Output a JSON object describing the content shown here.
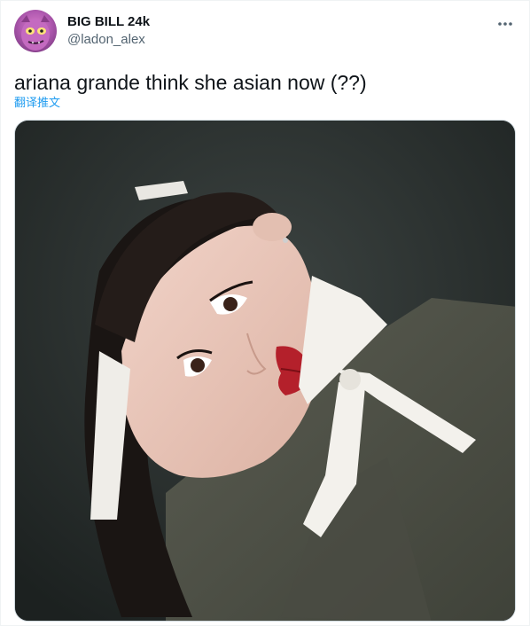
{
  "author": {
    "display_name": "BIG BILL 24k",
    "handle": "@ladon_alex"
  },
  "tweet": {
    "text": "ariana grande think she asian now (??)",
    "translate_label": "翻译推文"
  },
  "icons": {
    "more": "more-horizontal-icon"
  },
  "colors": {
    "link": "#1d9bf0",
    "secondary_text": "#536471",
    "primary_text": "#0f1419"
  }
}
